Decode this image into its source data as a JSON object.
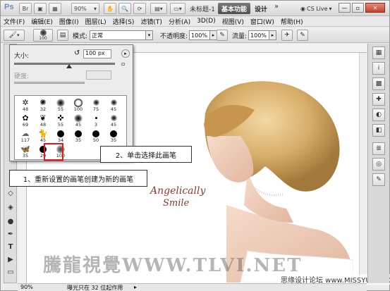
{
  "titlebar": {
    "app_logo": "Ps",
    "zoom": "90%",
    "doc_title": "未标题-1",
    "workspace_active": "基本功能",
    "workspace_design": "设计",
    "cs_live": "CS Live",
    "minimize": "—",
    "restore": "▫",
    "close": "✕"
  },
  "menu": [
    "文件(F)",
    "编辑(E)",
    "图像(I)",
    "图层(L)",
    "选择(S)",
    "滤镜(T)",
    "分析(A)",
    "3D(D)",
    "视图(V)",
    "窗口(W)",
    "帮助(H)"
  ],
  "options": {
    "brush_size": "100",
    "mode_label": "模式:",
    "mode_value": "正常",
    "opacity_label": "不透明度:",
    "opacity_value": "100%",
    "flow_label": "流量:",
    "flow_value": "100%"
  },
  "picker": {
    "size_label": "大小:",
    "size_value": "100 px",
    "hardness_label": "硬度:",
    "brushes": [
      {
        "n": "48",
        "g": "scatter"
      },
      {
        "n": "32",
        "g": "star"
      },
      {
        "n": "55",
        "g": "soft"
      },
      {
        "n": "100",
        "g": "ring"
      },
      {
        "n": "75",
        "g": "softsm"
      },
      {
        "n": "45",
        "g": "softsm"
      },
      {
        "n": "69",
        "g": "flower"
      },
      {
        "n": "48",
        "g": "leaf"
      },
      {
        "n": "55",
        "g": "cross"
      },
      {
        "n": "45",
        "g": "soft"
      },
      {
        "n": "3",
        "g": "dot"
      },
      {
        "n": "45",
        "g": "softsm"
      },
      {
        "n": "117",
        "g": "cloud"
      },
      {
        "n": "45",
        "g": "cat"
      },
      {
        "n": "34",
        "g": "hard"
      },
      {
        "n": "35",
        "g": "hard"
      },
      {
        "n": "50",
        "g": "hard"
      },
      {
        "n": "35",
        "g": "hard"
      },
      {
        "n": "35",
        "g": "butterfly"
      },
      {
        "n": "29",
        "g": "hard"
      },
      {
        "n": "100",
        "g": "ring2"
      }
    ]
  },
  "callouts": {
    "step1": "1、重新设置的画笔创建为新的画笔",
    "step2": "2、单击选择此画笔"
  },
  "photo": {
    "logo_line1": "Angelically",
    "logo_line2": "Smile"
  },
  "watermark": "騰龍視覺WWW.TLVI.NET",
  "site_mark": "思缘设计论坛 www.MISSYUAN.COM",
  "status": {
    "zoom": "90%",
    "info": "曝光只在 32 位起作用"
  },
  "colors": {
    "accent_red": "#e01a1a",
    "hair": "#d8ae6a",
    "logo": "#8b3a2f"
  }
}
